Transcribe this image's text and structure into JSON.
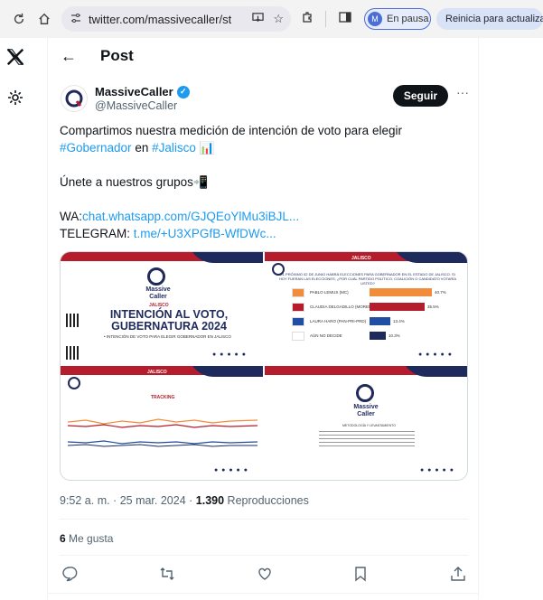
{
  "browser": {
    "url": "twitter.com/massivecaller/statu...",
    "profile_initial": "M",
    "profile_status": "En pausa",
    "update_label": "Reinicia para actualizar"
  },
  "header": {
    "title": "Post"
  },
  "tweet": {
    "author_name": "MassiveCaller",
    "author_handle": "@MassiveCaller",
    "follow_label": "Seguir",
    "more": "···",
    "text_line1": "Compartimos nuestra medición de intención de voto para elegir",
    "hashtag_gobernador": "#Gobernador",
    "text_en": "en",
    "hashtag_jalisco": "#Jalisco",
    "emoji_chart": "📊",
    "text_groups": "Únete a nuestros grupos",
    "emoji_phone": "📲",
    "wa_label": "WA:",
    "wa_link": "chat.whatsapp.com/GJQEoYlMu3iBJL...",
    "tg_label": "TELEGRAM:",
    "tg_link": "t.me/+U3XPGfB-WfDWc...",
    "time": "9:52 a. m. · 25 mar. 2024 ·",
    "views_count": "1.390",
    "views_label": "Reproducciones",
    "likes_count": "6",
    "likes_label": "Me gusta"
  },
  "media": {
    "tl": {
      "brand_line1": "Massive",
      "brand_line2": "Caller",
      "state": "JALISCO",
      "title": "INTENCIÓN AL VOTO, GUBERNATURA 2024",
      "bullet": "• INTENCIÓN DE VOTO PARA ELEGIR GOBERNADOR EN JALISCO"
    },
    "tr": {
      "state": "JALISCO",
      "question": "EL PRÓXIMO 02 DE JUNIO HABRÁ ELECCIONES PARA GOBERNADOR EN EL ESTADO DE JALISCO. SI HOY FUERAN LAS ELECCIONES, ¿POR CUÁL PARTIDO POLÍTICO, COALICIÓN O CANDIDATO VOTARÍA USTED?",
      "rows": [
        {
          "label": "PABLO LEMUS (MC)",
          "value": "40.7%",
          "pct": 0.407,
          "color": "#f08c3a",
          "logo": "#f08c3a"
        },
        {
          "label": "CLAUDIA DELGADILLO (MORENA-PT-PVEM)",
          "value": "35.5%",
          "pct": 0.355,
          "color": "#b51d2c",
          "logo": "#b51d2c"
        },
        {
          "label": "LAURA HARO (PAN-PRI-PRD)",
          "value": "13.4%",
          "pct": 0.134,
          "color": "#1f4ea3",
          "logo": "#1f4ea3"
        },
        {
          "label": "AÚN NO DECIDE",
          "value": "10.3%",
          "pct": 0.103,
          "color": "#1f2a5c",
          "logo": "#ffffff"
        }
      ]
    },
    "bl": {
      "state": "JALISCO",
      "subtitle": "TRACKING"
    },
    "br": {
      "brand_line1": "Massive",
      "brand_line2": "Caller",
      "heading": "METODOLOGÍA Y LEVANTAMIENTO"
    }
  },
  "colors": {
    "accent": "#1d9bf0",
    "brand_navy": "#1f2a5c",
    "brand_red": "#b51d2c"
  }
}
